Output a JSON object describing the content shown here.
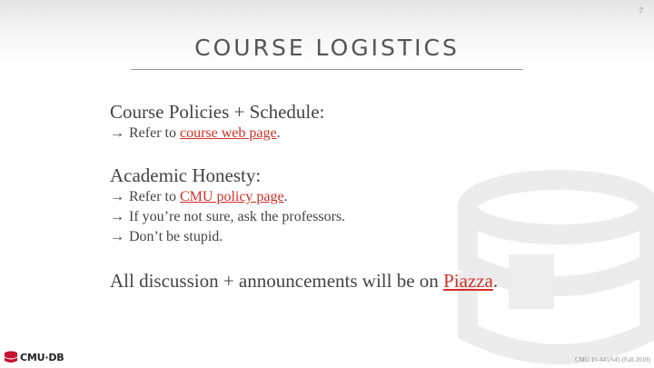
{
  "slide": {
    "page_number": "7",
    "title": "COURSE LOGISTICS",
    "sections": {
      "policies": {
        "heading": "Course Policies + Schedule:",
        "bullet_prefix": "Refer to ",
        "link_text": "course web page",
        "bullet_suffix": "."
      },
      "honesty": {
        "heading": "Academic Honesty:",
        "bullet1_prefix": "Refer to ",
        "bullet1_link": "CMU policy page",
        "bullet1_suffix": ".",
        "bullet2": "If you’re not sure, ask the professors.",
        "bullet3": "Don’t be stupid."
      }
    },
    "final": {
      "prefix": "All discussion + announcements will be on ",
      "link_text": "Piazza",
      "suffix": "."
    },
    "arrow": "→",
    "logo_text": "CMU·DB",
    "footer": "CMU 15-445/645 (Fall 2019)"
  },
  "colors": {
    "link": "#d22f27",
    "title": "#555555",
    "body": "#444444",
    "logo_accent": "#c41230"
  }
}
